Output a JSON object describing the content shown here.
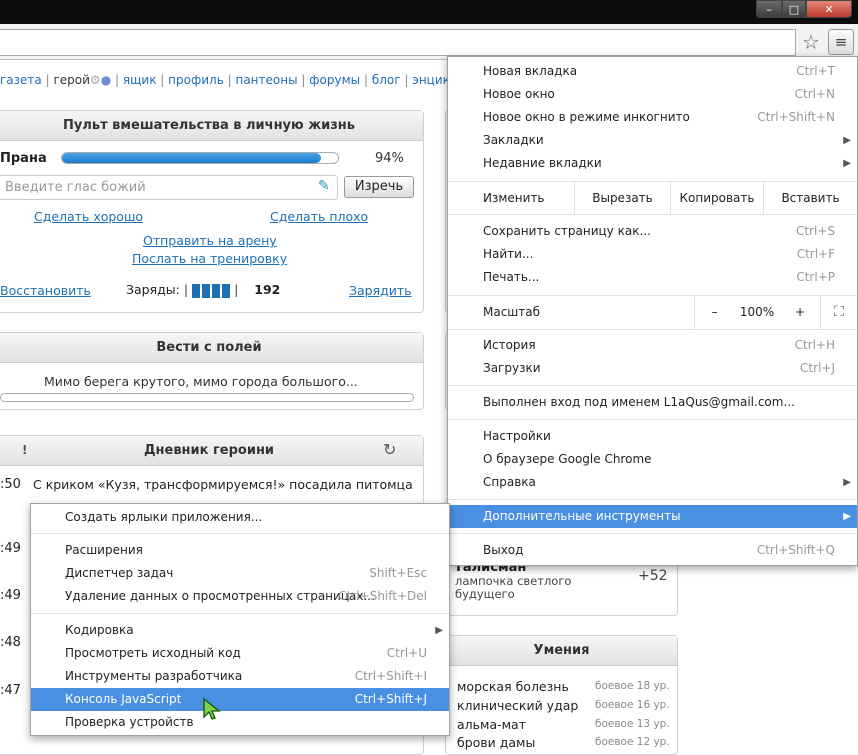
{
  "window": {
    "min": "–",
    "max": "□",
    "close": "✕"
  },
  "nav": {
    "items": [
      "газета",
      "герой",
      "ящик",
      "профиль",
      "пантеоны",
      "форумы",
      "блог",
      "энцикло"
    ],
    "sep": "|"
  },
  "intervention": {
    "title": "Пульт вмешательства в личную жизнь",
    "prana_label": "Прана",
    "prana_value": 0.94,
    "prana_text": "94%",
    "voice_placeholder": "Введите глас божий",
    "voice_button": "Изречь",
    "do_good": "Сделать хорошо",
    "do_bad": "Сделать плохо",
    "to_arena": "Отправить на арену",
    "to_training": "Послать на тренировку",
    "restore": "Восстановить",
    "charges_label": "Заряды:",
    "charges_count": 192,
    "charge_link": "Зарядить"
  },
  "news": {
    "title": "Вести с полей",
    "text": "Мимо берега крутого, мимо города большого..."
  },
  "diary": {
    "title": "Дневник героини",
    "bang": "!",
    "times": [
      ":50",
      ":49",
      ":49",
      ":48",
      ":47"
    ],
    "first_entry": "С криком «Кузя, трансформируемся!» посадила питомца"
  },
  "talisman": {
    "title": "Талисман",
    "desc": "лампочка светлого будущего",
    "value": "+52"
  },
  "skills": {
    "title": "Умения",
    "items": [
      {
        "name": "морская болезнь",
        "level": "боевое 18 ур."
      },
      {
        "name": "клинический удар",
        "level": "боевое 16 ур."
      },
      {
        "name": "альма-мат",
        "level": "боевое 13 ур."
      },
      {
        "name": "брови дамы",
        "level": "боевое 12 ур."
      }
    ]
  },
  "menu": {
    "new_tab": "Новая вкладка",
    "new_tab_sc": "Ctrl+T",
    "new_window": "Новое окно",
    "new_window_sc": "Ctrl+N",
    "incognito": "Новое окно в режиме инкогнито",
    "incognito_sc": "Ctrl+Shift+N",
    "bookmarks": "Закладки",
    "recent_tabs": "Недавние вкладки",
    "edit": "Изменить",
    "cut": "Вырезать",
    "copy": "Копировать",
    "paste": "Вставить",
    "save": "Сохранить страницу как...",
    "save_sc": "Ctrl+S",
    "find": "Найти...",
    "find_sc": "Ctrl+F",
    "print": "Печать...",
    "print_sc": "Ctrl+P",
    "zoom": "Масштаб",
    "zoom_minus": "–",
    "zoom_value": "100%",
    "zoom_plus": "+",
    "history": "История",
    "history_sc": "Ctrl+H",
    "downloads": "Загрузки",
    "downloads_sc": "Ctrl+J",
    "signed_in": "Выполнен вход под именем L1aQus@gmail.com...",
    "settings": "Настройки",
    "about": "О браузере Google Chrome",
    "help": "Справка",
    "more_tools": "Дополнительные инструменты",
    "exit": "Выход",
    "exit_sc": "Ctrl+Shift+Q"
  },
  "submenu": {
    "create_shortcuts": "Создать ярлыки приложения...",
    "extensions": "Расширения",
    "task_manager": "Диспетчер задач",
    "task_manager_sc": "Shift+Esc",
    "clear_data": "Удаление данных о просмотренных страницах...",
    "clear_data_sc": "Ctrl+Shift+Del",
    "encoding": "Кодировка",
    "view_source": "Просмотреть исходный код",
    "view_source_sc": "Ctrl+U",
    "dev_tools": "Инструменты разработчика",
    "dev_tools_sc": "Ctrl+Shift+I",
    "js_console": "Консоль JavaScript",
    "js_console_sc": "Ctrl+Shift+J",
    "inspect_devices": "Проверка устройств"
  }
}
